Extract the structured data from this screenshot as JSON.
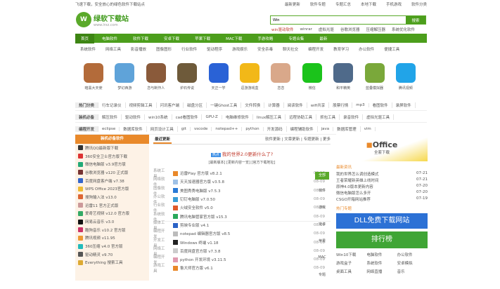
{
  "topbar": {
    "left": "飞速下载，安全放心的绿色软件下载站点",
    "links": [
      "最新更新",
      "软件专题",
      "专题汇总",
      "本地下载",
      "手机游戏",
      "软件分类"
    ]
  },
  "logo": {
    "mark": "W",
    "title": "绿软下载站",
    "url": "www.lrxz.com"
  },
  "search": {
    "value": "Win",
    "button": "搜索"
  },
  "hot": [
    "win驱动软件",
    "winrar",
    "虚拟光驱",
    "谷歌浏览器",
    "压缩解压器",
    "系统优化软件"
  ],
  "nav": [
    "首页",
    "电脑软件",
    "软件下载",
    "安卓下载",
    "苹果下载",
    "MAC下载",
    "手游攻略",
    "专题合集",
    "最新"
  ],
  "subnav": [
    "系统软件",
    "网络工具",
    "影音播放",
    "图像图形",
    "行业软件",
    "驱动程序",
    "游戏娱乐",
    "安全杀毒",
    "聊天社交",
    "编程开发",
    "教育学习",
    "办公软件",
    "便捷工具"
  ],
  "apps": [
    {
      "label": "暗黑大天使",
      "color": "#b36b3a"
    },
    {
      "label": "梦幻西游",
      "color": "#5fa3d9"
    },
    {
      "label": "恋与制作人",
      "color": "#8a5a3a"
    },
    {
      "label": "炉石传说",
      "color": "#6e5a3a"
    },
    {
      "label": "天正一学",
      "color": "#2a62d6"
    },
    {
      "label": "逗游游戏盒",
      "color": "#f2b818"
    },
    {
      "label": "恋恋",
      "color": "#d9a88a"
    },
    {
      "label": "微信",
      "color": "#1bc31b"
    },
    {
      "label": "和平精英",
      "color": "#4f6a8a"
    },
    {
      "label": "蓝叠模拟器",
      "color": "#7aa83a"
    },
    {
      "label": "腾讯视频",
      "color": "#21a4e8"
    }
  ],
  "tags": [
    [
      "热门分类",
      "行车记录仪",
      "视频剪辑工具",
      "闪讯客户端",
      "磁盘分区",
      "一键Ghost工具",
      "文件转换",
      "计算器",
      "阅读软件",
      "wifi共享",
      "股票行情",
      "mp3",
      "看图软件",
      "录屏软件"
    ],
    [
      "装机必备",
      "解压软件",
      "驱动软件",
      "win10系统",
      "cad看图软件",
      "GPU-Z",
      "电脑维修软件",
      "linux解压工具",
      "远程协助工具",
      "抓包工具",
      "录音软件",
      "虚拟光驱工具"
    ],
    [
      "编程开发",
      "eclipse",
      "数据库软件",
      "网页设计工具",
      "git",
      "vscode",
      "notepad++",
      "python",
      "开发源码",
      "编程辅助软件",
      "java",
      "数据库管理",
      "vim"
    ]
  ],
  "left": {
    "title": "装机必备软件",
    "items": [
      "腾讯QQ最新版下载",
      "360安全卫士官方版下载",
      "微信电脑版 v3.9官方版",
      "谷歌浏览器 v120 正式版",
      "百度网盘客户端 v7.38",
      "WPS Office 2023官方版",
      "搜狗输入法 v13.0",
      "迅雷11 官方正式版",
      "爱奇艺视频 v12.0 官方版",
      "网易云音乐 v3.0",
      "酷狗音乐 v10.2 官方版",
      "腾讯视频 v11.95",
      "360压缩 v4.0 官方版",
      "驱动精灵 v9.70",
      "Everything 搜索工具"
    ]
  },
  "mid": {
    "tab": "最近更新",
    "tab_links": "软件更新 | 文章更新 | 专题更新 | 更多",
    "headline_badge": "热点",
    "headline": "我的世界2.0更新什么了?",
    "subline": "[最新版本] [更新内容一览] [官方下载地址]",
    "rows": [
      {
        "cat": "系统工具",
        "name": "迅雷Play 官方版 v8.2.1",
        "date": "08-12",
        "color": "#e9892a"
      },
      {
        "cat": "网络软件",
        "name": "天天加速器官方版 v3.5.8",
        "date": "08-09",
        "color": "#9fc1e6"
      },
      {
        "cat": "图像软件",
        "name": "美图秀秀电脑版 v7.5.3",
        "date": "08-09",
        "color": "#2a7ad6"
      },
      {
        "cat": "办公软件",
        "name": "钉钉电脑版 v7.0.50",
        "date": "08-09",
        "color": "#3a9ed6"
      },
      {
        "cat": "行业软件",
        "name": "火绒安全软件 v5.0",
        "date": "08-09",
        "color": "#e05a2a"
      },
      {
        "cat": "系统软件",
        "name": "腾讯电脑管家官方版 v15.3",
        "date": "08-09",
        "color": "#2aa85a"
      },
      {
        "cat": "媒体工具",
        "name": "剪映专业版 v4.1",
        "date": "08-09",
        "color": "#2a62c6"
      },
      {
        "cat": "编程开发",
        "name": "notepad 编辑器官方版 v8.5",
        "date": "08-09",
        "color": "#bbb"
      },
      {
        "cat": "开发工具",
        "name": "Windows 终端 v1.18",
        "date": "08-09",
        "color": "#222"
      },
      {
        "cat": "网络工具",
        "name": "百度网盘官方版 v7.3.8",
        "date": "08-09",
        "color": "#ccc"
      },
      {
        "cat": "编程开发",
        "name": "python 开发环境 v3.11.5",
        "date": "08-09",
        "color": "#e09ab0"
      },
      {
        "cat": "游戏工具",
        "name": "鲁大师官方版 v6.1",
        "date": "08-09",
        "color": "#e9892a"
      }
    ],
    "side": [
      "全部",
      "软件",
      "游戏",
      "安卓",
      "苹果",
      "MAC",
      "专题"
    ]
  },
  "right": {
    "office_title": "Office",
    "office_sub": "全套下载",
    "news_title": "最新资讯",
    "news": [
      [
        "我的世界怎么调创造模式",
        "07-21"
      ],
      [
        "王者荣耀新英雄上线时间",
        "07-21"
      ],
      [
        "原神4.0版本更新内容",
        "07-20"
      ],
      [
        "微信电脑版怎么多开",
        "07-20"
      ],
      [
        "CSGO开箱网站推荐",
        "07-19"
      ]
    ],
    "special_title": "热门专题",
    "dll": "DLL免费下载网站",
    "rank": "排行榜",
    "grid": [
      "Win10下载",
      "电脑软件",
      "办公软件",
      "游戏盒子",
      "系统软件",
      "安卓模拟",
      "桌面工具",
      "网络直播",
      "音乐"
    ]
  }
}
